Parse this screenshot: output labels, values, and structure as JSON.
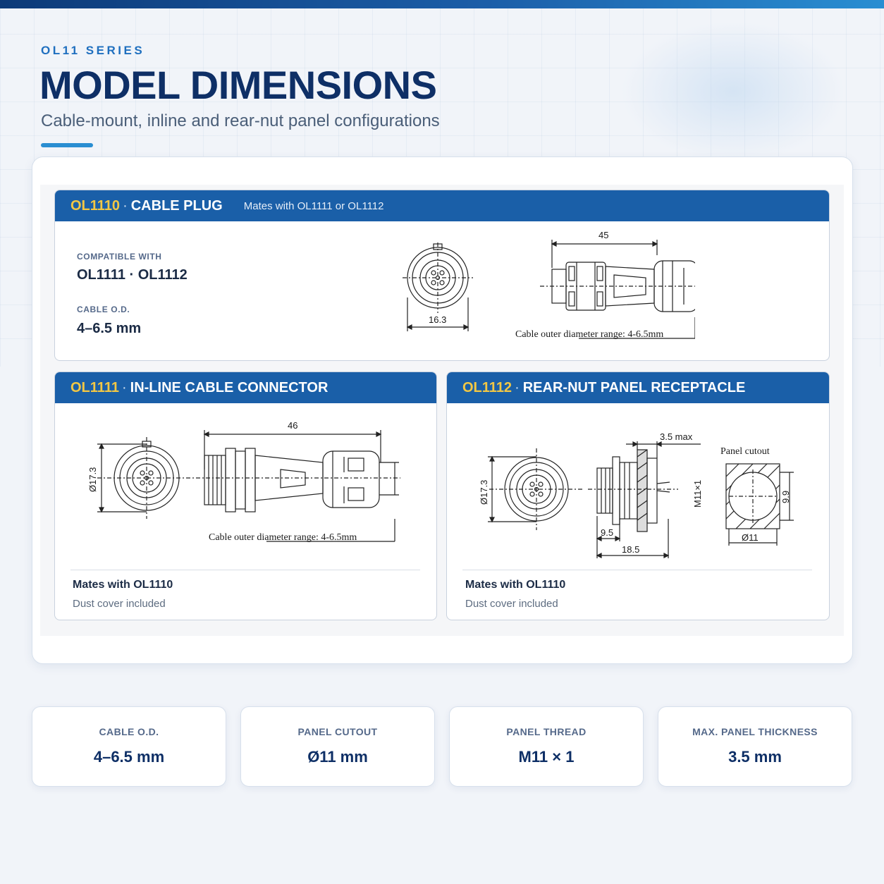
{
  "header": {
    "eyebrow": "OL11 SERIES",
    "title": "MODEL DIMENSIONS",
    "subtitle": "Cable-mount, inline and rear-nut panel configurations"
  },
  "panels": {
    "plug": {
      "code": "OL1110",
      "sep": "·",
      "title": "CABLE PLUG",
      "note": "Mates with OL1111 or OL1112",
      "compat_label": "COMPATIBLE WITH",
      "compat_value": "OL1111 · OL1112",
      "od_label": "CABLE O.D.",
      "od_value": "4–6.5 mm",
      "drawing": {
        "front_width": "16.3",
        "length": "45",
        "cable_note": "Cable outer  diameter range: 4-6.5mm"
      }
    },
    "inline": {
      "code": "OL1111",
      "sep": "·",
      "title": "IN-LINE CABLE CONNECTOR",
      "mates": "Mates with OL1110",
      "dust": "Dust cover included",
      "drawing": {
        "diameter": "Ø17.3",
        "length": "46",
        "cable_note": "Cable outer  diameter range: 4-6.5mm"
      }
    },
    "receptacle": {
      "code": "OL1112",
      "sep": "·",
      "title": "REAR-NUT PANEL RECEPTACLE",
      "mates": "Mates with OL1110",
      "dust": "Dust cover included",
      "drawing": {
        "diameter": "Ø17.3",
        "max_thickness": "3.5 max",
        "thread": "M11×1",
        "dim_a": "9.5",
        "dim_b": "18.5",
        "cutout_label": "Panel cutout",
        "cutout_flat": "9.9",
        "cutout_dia": "Ø11"
      }
    }
  },
  "specs": [
    {
      "label": "CABLE O.D.",
      "value": "4–6.5 mm"
    },
    {
      "label": "PANEL CUTOUT",
      "value": "Ø11 mm"
    },
    {
      "label": "PANEL THREAD",
      "value": "M11 × 1"
    },
    {
      "label": "MAX. PANEL THICKNESS",
      "value": "3.5 mm"
    }
  ]
}
